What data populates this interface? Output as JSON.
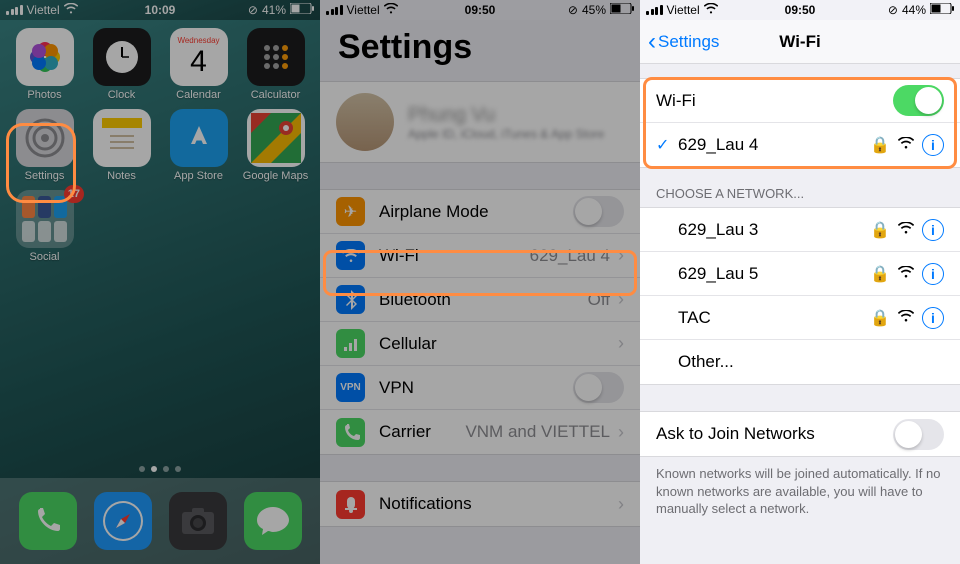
{
  "screen1": {
    "status": {
      "carrier": "Viettel",
      "time": "10:09",
      "battery": "41%"
    },
    "apps": [
      {
        "label": "Photos",
        "icon": "photos",
        "bg": "#fff"
      },
      {
        "label": "Clock",
        "icon": "clock",
        "bg": "#1c1c1e"
      },
      {
        "label": "Calendar",
        "icon": "calendar",
        "bg": "#fff",
        "line1": "Wednesday",
        "line2": "4"
      },
      {
        "label": "Calculator",
        "icon": "calc",
        "bg": "#1c1c1e"
      },
      {
        "label": "Settings",
        "icon": "settings",
        "bg": "#d8d8dc",
        "highlight": true
      },
      {
        "label": "Notes",
        "icon": "notes",
        "bg": "#fff"
      },
      {
        "label": "App Store",
        "icon": "appstore",
        "bg": "#1da1f2"
      },
      {
        "label": "Google Maps",
        "icon": "maps",
        "bg": "#fff"
      },
      {
        "label": "Social",
        "icon": "folder",
        "badge": "17"
      }
    ],
    "dock": [
      {
        "label": "Phone",
        "bg": "#4cd964"
      },
      {
        "label": "Safari",
        "bg": "#1f9bff"
      },
      {
        "label": "Camera",
        "bg": "#3a3a3c"
      },
      {
        "label": "Messages",
        "bg": "#4cd964"
      }
    ]
  },
  "screen2": {
    "status": {
      "carrier": "Viettel",
      "time": "09:50",
      "battery": "45%"
    },
    "title": "Settings",
    "profile": {
      "name": "Phung Vu",
      "sub": "Apple ID, iCloud, iTunes & App Store"
    },
    "rows": [
      {
        "icon": "airplane",
        "bg": "#ff9500",
        "label": "Airplane Mode",
        "toggle": false
      },
      {
        "icon": "wifi",
        "bg": "#007aff",
        "label": "Wi-Fi",
        "value": "629_Lau 4",
        "highlight": true
      },
      {
        "icon": "bt",
        "bg": "#007aff",
        "label": "Bluetooth",
        "value": "Off"
      },
      {
        "icon": "cell",
        "bg": "#4cd964",
        "label": "Cellular"
      },
      {
        "icon": "vpn",
        "bg": "#007aff",
        "label": "VPN",
        "toggle": false
      },
      {
        "icon": "carrier",
        "bg": "#4cd964",
        "label": "Carrier",
        "value": "VNM and VIETTEL"
      }
    ],
    "rows2": [
      {
        "icon": "notif",
        "bg": "#ff3b30",
        "label": "Notifications"
      }
    ]
  },
  "screen3": {
    "status": {
      "carrier": "Viettel",
      "time": "09:50",
      "battery": "44%"
    },
    "back": "Settings",
    "title": "Wi-Fi",
    "wifi_label": "Wi-Fi",
    "wifi_on": true,
    "connected": {
      "name": "629_Lau 4",
      "locked": true
    },
    "choose_header": "CHOOSE A NETWORK...",
    "networks": [
      {
        "name": "629_Lau 3",
        "locked": true
      },
      {
        "name": "629_Lau 5",
        "locked": true
      },
      {
        "name": "TAC",
        "locked": true
      }
    ],
    "other": "Other...",
    "ask_label": "Ask to Join Networks",
    "ask_on": false,
    "footer": "Known networks will be joined automatically. If no known networks are available, you will have to manually select a network."
  }
}
